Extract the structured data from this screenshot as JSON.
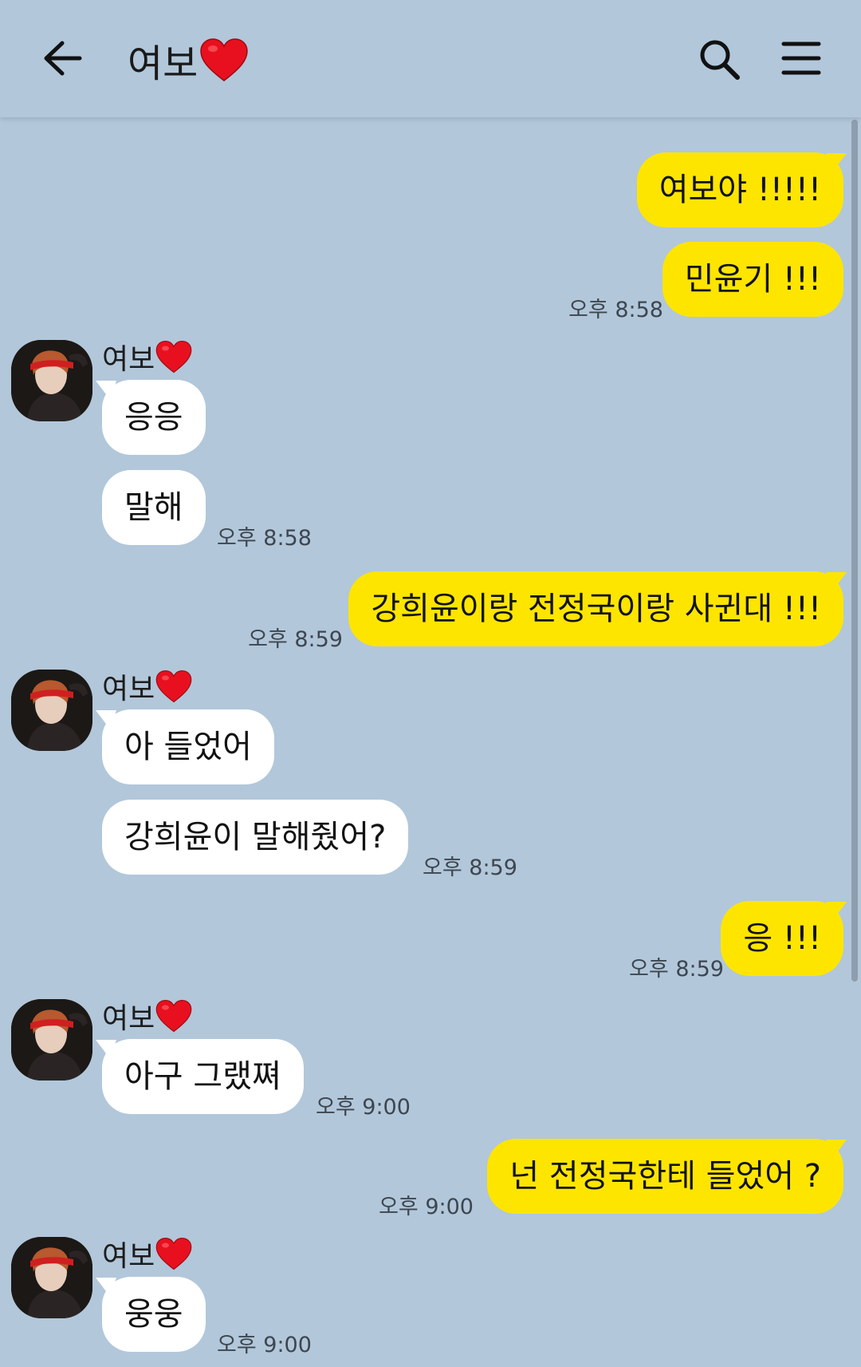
{
  "header": {
    "title": "여보",
    "back_icon": "arrow-left-icon",
    "search_icon": "search-icon",
    "menu_icon": "hamburger-menu-icon",
    "heart_color": "#e8101f"
  },
  "colors": {
    "background": "#b2c7da",
    "my_bubble": "#fee500",
    "their_bubble": "#ffffff"
  },
  "messages": [
    {
      "from": "me",
      "text": "여보야 !!!!!"
    },
    {
      "from": "me",
      "text": "민윤기 !!!",
      "time": "오후 8:58"
    },
    {
      "from": "them",
      "sender": "여보",
      "text": "응응"
    },
    {
      "from": "them",
      "text": "말해",
      "time": "오후 8:58"
    },
    {
      "from": "me",
      "text": "강희윤이랑 전정국이랑 사귄대 !!!",
      "time": "오후 8:59"
    },
    {
      "from": "them",
      "sender": "여보",
      "text": "아 들었어"
    },
    {
      "from": "them",
      "text": "강희윤이 말해줬어?",
      "time": "오후 8:59"
    },
    {
      "from": "me",
      "text": "응 !!!",
      "time": "오후 8:59"
    },
    {
      "from": "them",
      "sender": "여보",
      "text": "아구 그랬쪄",
      "time": "오후 9:00"
    },
    {
      "from": "me",
      "text": "넌 전정국한테 들었어 ?",
      "time": "오후 9:00"
    },
    {
      "from": "them",
      "sender": "여보",
      "text": "웅웅",
      "time": "오후 9:00"
    }
  ]
}
